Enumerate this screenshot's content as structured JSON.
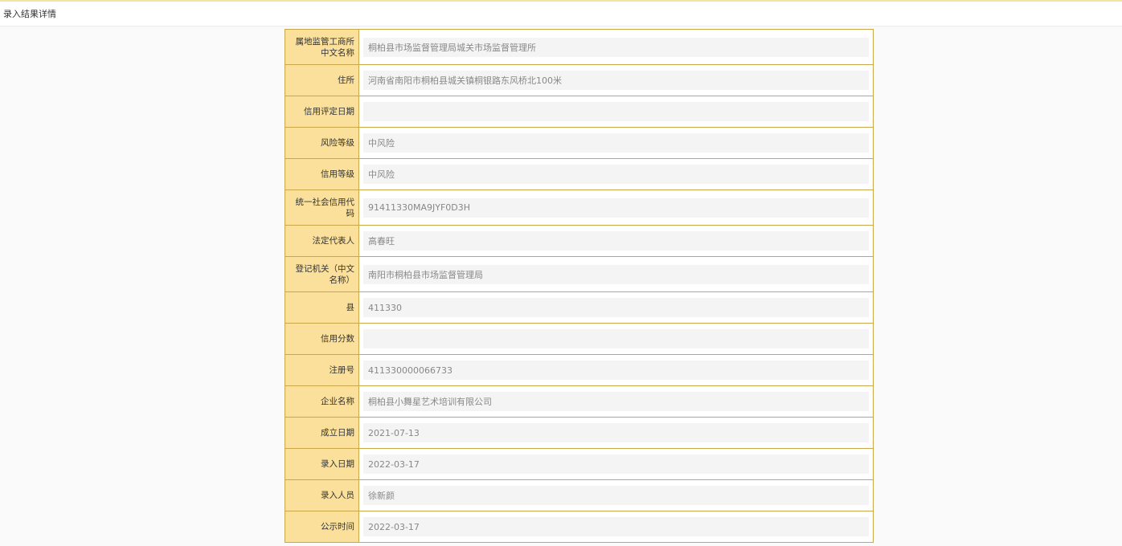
{
  "header": {
    "title": "录入结果详情"
  },
  "colors": {
    "label_bg": "#fbe09b",
    "border": "#c9a84c",
    "value_bg": "#f4f4f4",
    "top_accent": "#f3e3a4"
  },
  "fields": [
    {
      "key": "supervision-office",
      "label": "属地监管工商所中文名称",
      "value": "桐柏县市场监督管理局城关市场监督管理所"
    },
    {
      "key": "address",
      "label": "住所",
      "value": "河南省南阳市桐柏县城关镇桐银路东风桥北100米"
    },
    {
      "key": "credit-eval-date",
      "label": "信用评定日期",
      "value": ""
    },
    {
      "key": "risk-level",
      "label": "风险等级",
      "value": "中风险"
    },
    {
      "key": "credit-level",
      "label": "信用等级",
      "value": "中风险"
    },
    {
      "key": "unified-credit-code",
      "label": "统一社会信用代码",
      "value": "91411330MA9JYF0D3H"
    },
    {
      "key": "legal-rep",
      "label": "法定代表人",
      "value": "高春旺"
    },
    {
      "key": "reg-authority",
      "label": "登记机关（中文名称）",
      "value": "南阳市桐柏县市场监督管理局"
    },
    {
      "key": "county",
      "label": "县",
      "value": "411330"
    },
    {
      "key": "credit-score",
      "label": "信用分数",
      "value": ""
    },
    {
      "key": "reg-number",
      "label": "注册号",
      "value": "411330000066733"
    },
    {
      "key": "company-name",
      "label": "企业名称",
      "value": "桐柏县小舞星艺术培训有限公司"
    },
    {
      "key": "est-date",
      "label": "成立日期",
      "value": "2021-07-13"
    },
    {
      "key": "entry-date",
      "label": "录入日期",
      "value": "2022-03-17"
    },
    {
      "key": "entry-person",
      "label": "录入人员",
      "value": "徐新颜"
    },
    {
      "key": "publish-time",
      "label": "公示时间",
      "value": "2022-03-17"
    }
  ]
}
